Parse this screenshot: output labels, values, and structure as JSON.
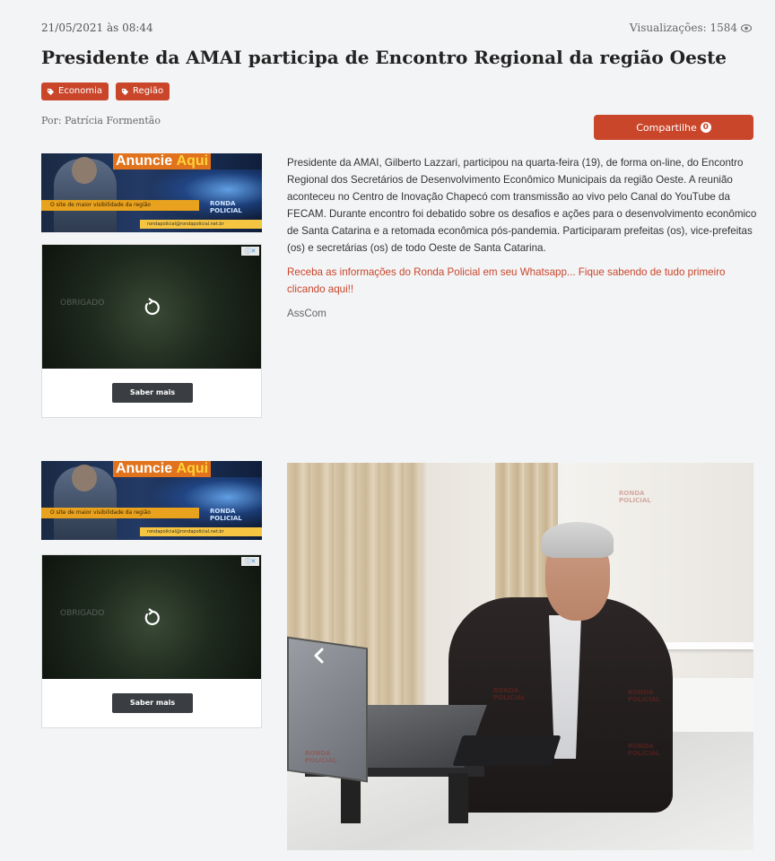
{
  "post": {
    "date": "21/05/2021 às 08:44",
    "views_label": "Visualizações: 1584",
    "title": "Presidente da AMAI participa de Encontro Regional da região Oeste",
    "tags": [
      "Economia",
      "Região"
    ],
    "author": "Por: Patrícia Formentão",
    "share_label": "Compartilhe",
    "share_count": "0"
  },
  "ads": {
    "banner_title_1": "Anuncie",
    "banner_title_2": "Aqui",
    "banner_tagline": "O site de maior visibilidade da região",
    "banner_brand_1": "RONDA",
    "banner_brand_2": "POLICIAL",
    "banner_url": "rondapolicial@rondapolicial.net.br",
    "box_watermark": "OBRIGADO",
    "box_button": "Saber mais"
  },
  "article": {
    "body": "Presidente da AMAI, Gilberto Lazzari, participou na quarta-feira (19), de forma on-line, do Encontro Regional dos Secretários de Desenvolvimento Econômico Municipais da região Oeste. A reunião aconteceu no Centro de Inovação Chapecó com transmissão ao vivo pelo Canal do YouTube da FECAM. Durante encontro foi debatido sobre os desafios e ações para o desenvolvimento econômico de Santa Catarina e a retomada econômica pós-pandemia. Participaram prefeitas (os), vice-prefeitas (os) e secretárias (os) de todo Oeste de Santa Catarina.",
    "cta": "Receba as informações do Ronda Policial em seu Whatsapp... Fique sabendo de tudo primeiro clicando aqui!!",
    "source": "AssCom"
  },
  "photo": {
    "watermark_1": "RONDA",
    "watermark_2": "POLICIAL"
  },
  "colors": {
    "accent": "#c9462b",
    "background": "#f3f4f6"
  },
  "icons": {
    "views": "eye-icon",
    "tag": "tag-icon",
    "reload": "reload-icon",
    "prev": "chevron-left-icon"
  }
}
